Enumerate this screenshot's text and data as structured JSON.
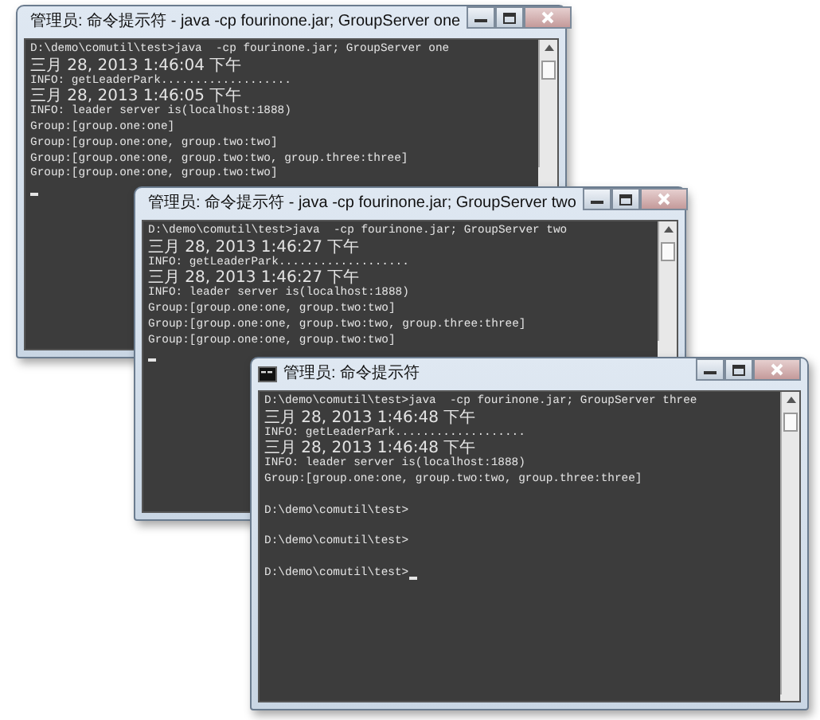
{
  "windows": [
    {
      "title": "管理员: 命令提示符 - java  -cp fourinone.jar; GroupServer one",
      "cursor_inline": false,
      "lines": [
        {
          "kind": "ascii",
          "text": "D:\\demo\\comutil\\test>java  -cp fourinone.jar; GroupServer one"
        },
        {
          "kind": "date",
          "text": "三月 28, 2013 1:46:04 下午"
        },
        {
          "kind": "ascii",
          "text": "INFO: getLeaderPark..................."
        },
        {
          "kind": "date",
          "text": "三月 28, 2013 1:46:05 下午"
        },
        {
          "kind": "ascii",
          "text": "INFO: leader server is(localhost:1888)"
        },
        {
          "kind": "ascii",
          "text": "Group:[group.one:one]"
        },
        {
          "kind": "ascii",
          "text": "Group:[group.one:one, group.two:two]"
        },
        {
          "kind": "ascii",
          "text": "Group:[group.one:one, group.two:two, group.three:three]"
        },
        {
          "kind": "ascii",
          "text": "Group:[group.one:one, group.two:two]"
        }
      ]
    },
    {
      "title": "管理员: 命令提示符 - java  -cp fourinone.jar; GroupServer two",
      "cursor_inline": false,
      "lines": [
        {
          "kind": "ascii",
          "text": "D:\\demo\\comutil\\test>java  -cp fourinone.jar; GroupServer two"
        },
        {
          "kind": "date",
          "text": "三月 28, 2013 1:46:27 下午"
        },
        {
          "kind": "ascii",
          "text": "INFO: getLeaderPark..................."
        },
        {
          "kind": "date",
          "text": "三月 28, 2013 1:46:27 下午"
        },
        {
          "kind": "ascii",
          "text": "INFO: leader server is(localhost:1888)"
        },
        {
          "kind": "ascii",
          "text": "Group:[group.one:one, group.two:two]"
        },
        {
          "kind": "ascii",
          "text": "Group:[group.one:one, group.two:two, group.three:three]"
        },
        {
          "kind": "ascii",
          "text": "Group:[group.one:one, group.two:two]"
        }
      ]
    },
    {
      "title": "管理员: 命令提示符",
      "cursor_inline": true,
      "lines": [
        {
          "kind": "ascii",
          "text": "D:\\demo\\comutil\\test>java  -cp fourinone.jar; GroupServer three"
        },
        {
          "kind": "date",
          "text": "三月 28, 2013 1:46:48 下午"
        },
        {
          "kind": "ascii",
          "text": "INFO: getLeaderPark..................."
        },
        {
          "kind": "date",
          "text": "三月 28, 2013 1:46:48 下午"
        },
        {
          "kind": "ascii",
          "text": "INFO: leader server is(localhost:1888)"
        },
        {
          "kind": "ascii",
          "text": "Group:[group.one:one, group.two:two, group.three:three]"
        },
        {
          "kind": "blank"
        },
        {
          "kind": "ascii",
          "text": "D:\\demo\\comutil\\test>"
        },
        {
          "kind": "blank"
        },
        {
          "kind": "ascii",
          "text": "D:\\demo\\comutil\\test>"
        },
        {
          "kind": "blank"
        },
        {
          "kind": "ascii",
          "text": "D:\\demo\\comutil\\test>"
        }
      ]
    }
  ]
}
